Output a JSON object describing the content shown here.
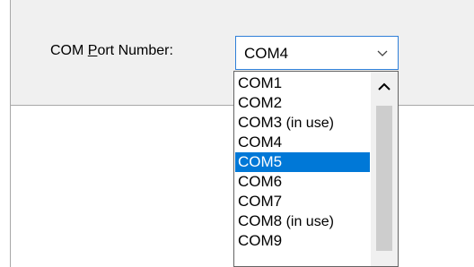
{
  "dialog": {
    "label_prefix": "COM ",
    "label_mnemonic": "P",
    "label_suffix": "ort Number:",
    "combo": {
      "value": "COM4",
      "icon": "chevron-down-icon"
    },
    "dropdown": {
      "selected_index": 4,
      "items": [
        {
          "label": "COM1",
          "suffix": ""
        },
        {
          "label": "COM2",
          "suffix": ""
        },
        {
          "label": "COM3",
          "suffix": " (in use)"
        },
        {
          "label": "COM4",
          "suffix": ""
        },
        {
          "label": "COM5",
          "suffix": ""
        },
        {
          "label": "COM6",
          "suffix": ""
        },
        {
          "label": "COM7",
          "suffix": ""
        },
        {
          "label": "COM8",
          "suffix": " (in use)"
        },
        {
          "label": "COM9",
          "suffix": ""
        }
      ],
      "scroll_up_icon": "chevron-up-icon"
    }
  },
  "colors": {
    "selection": "#0078d7",
    "focus_border": "#2f7fd8",
    "panel_bg": "#f0f0f0"
  }
}
